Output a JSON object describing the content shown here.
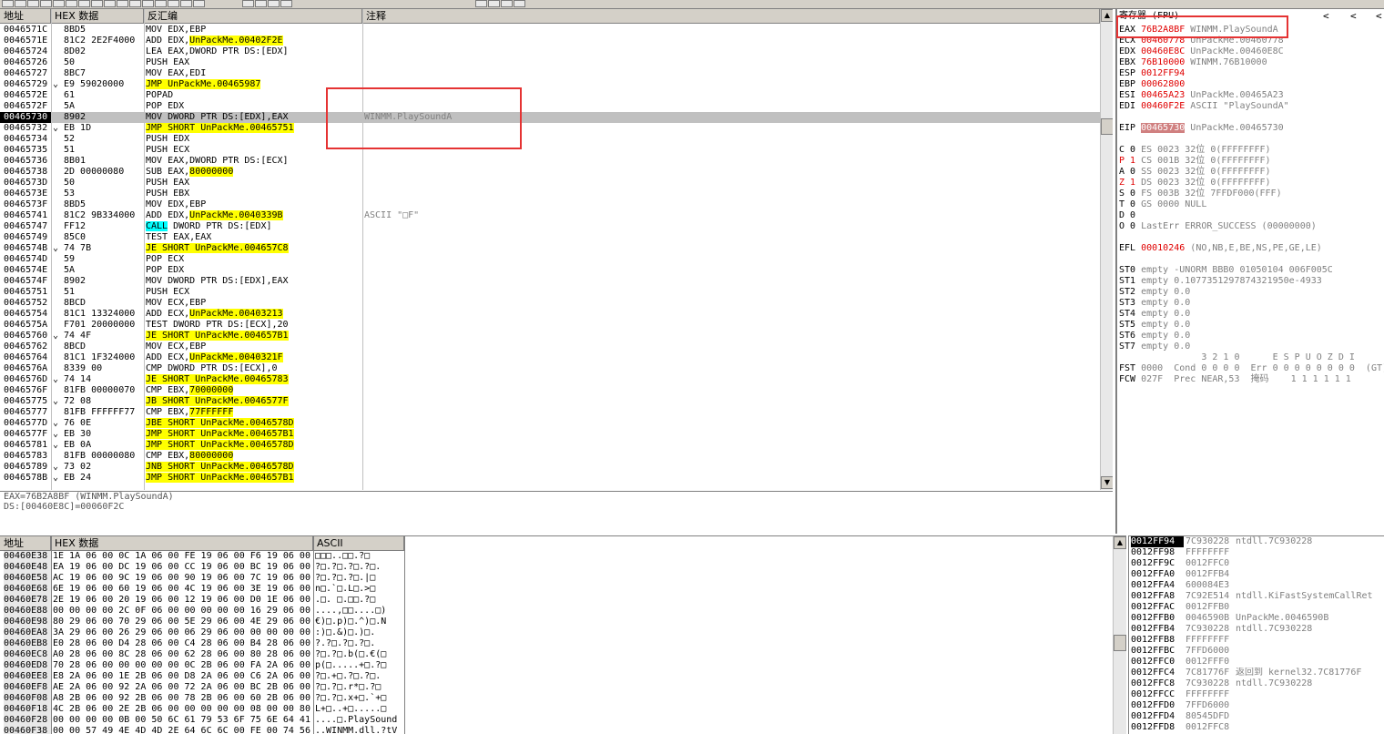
{
  "disasm": {
    "headers": {
      "address": "地址",
      "hex": "HEX 数据",
      "disasm": "反汇编",
      "comment": "注释"
    },
    "rows": [
      {
        "addr": "0046571C",
        "arrow": "",
        "hex": "8BD5",
        "parts": [
          {
            "t": "MOV EDX,EBP"
          }
        ],
        "comment": ""
      },
      {
        "addr": "0046571E",
        "arrow": "",
        "hex": "81C2 2E2F4000",
        "parts": [
          {
            "t": "ADD EDX,"
          },
          {
            "t": "UnPackMe.00402F2E",
            "c": "y"
          }
        ],
        "comment": ""
      },
      {
        "addr": "00465724",
        "arrow": "",
        "hex": "8D02",
        "parts": [
          {
            "t": "LEA EAX,DWORD PTR DS:[EDX]"
          }
        ],
        "comment": ""
      },
      {
        "addr": "00465726",
        "arrow": "",
        "hex": "50",
        "parts": [
          {
            "t": "PUSH EAX"
          }
        ],
        "comment": ""
      },
      {
        "addr": "00465727",
        "arrow": "",
        "hex": "8BC7",
        "parts": [
          {
            "t": "MOV EAX,EDI"
          }
        ],
        "comment": ""
      },
      {
        "addr": "00465729",
        "arrow": "⌄",
        "hex": "E9 59020000",
        "parts": [
          {
            "t": "JMP UnPackMe.00465987",
            "c": "y"
          }
        ],
        "comment": ""
      },
      {
        "addr": "0046572E",
        "arrow": "",
        "hex": "61",
        "parts": [
          {
            "t": "POPAD"
          }
        ],
        "comment": ""
      },
      {
        "addr": "0046572F",
        "arrow": "",
        "hex": "5A",
        "parts": [
          {
            "t": "POP EDX"
          }
        ],
        "comment": ""
      },
      {
        "addr": "00465730",
        "arrow": "",
        "hex": "8902",
        "parts": [
          {
            "t": "MOV DWORD PTR DS:[EDX],EAX"
          }
        ],
        "comment": "WINMM.PlaySoundA",
        "sel": true
      },
      {
        "addr": "00465732",
        "arrow": "⌄",
        "hex": "EB 1D",
        "parts": [
          {
            "t": "JMP SHORT UnPackMe.00465751",
            "c": "y"
          }
        ],
        "comment": ""
      },
      {
        "addr": "00465734",
        "arrow": "",
        "hex": "52",
        "parts": [
          {
            "t": "PUSH EDX"
          }
        ],
        "comment": ""
      },
      {
        "addr": "00465735",
        "arrow": "",
        "hex": "51",
        "parts": [
          {
            "t": "PUSH ECX"
          }
        ],
        "comment": ""
      },
      {
        "addr": "00465736",
        "arrow": "",
        "hex": "8B01",
        "parts": [
          {
            "t": "MOV EAX,DWORD PTR DS:[ECX]"
          }
        ],
        "comment": ""
      },
      {
        "addr": "00465738",
        "arrow": "",
        "hex": "2D 00000080",
        "parts": [
          {
            "t": "SUB EAX,"
          },
          {
            "t": "80000000",
            "c": "y"
          }
        ],
        "comment": ""
      },
      {
        "addr": "0046573D",
        "arrow": "",
        "hex": "50",
        "parts": [
          {
            "t": "PUSH EAX"
          }
        ],
        "comment": ""
      },
      {
        "addr": "0046573E",
        "arrow": "",
        "hex": "53",
        "parts": [
          {
            "t": "PUSH EBX"
          }
        ],
        "comment": ""
      },
      {
        "addr": "0046573F",
        "arrow": "",
        "hex": "8BD5",
        "parts": [
          {
            "t": "MOV EDX,EBP"
          }
        ],
        "comment": ""
      },
      {
        "addr": "00465741",
        "arrow": "",
        "hex": "81C2 9B334000",
        "parts": [
          {
            "t": "ADD EDX,"
          },
          {
            "t": "UnPackMe.0040339B",
            "c": "y"
          }
        ],
        "comment": "ASCII \"□F\""
      },
      {
        "addr": "00465747",
        "arrow": "",
        "hex": "FF12",
        "parts": [
          {
            "t": "CALL",
            "c": "c"
          },
          {
            "t": " DWORD PTR DS:[EDX]"
          }
        ],
        "comment": ""
      },
      {
        "addr": "00465749",
        "arrow": "",
        "hex": "85C0",
        "parts": [
          {
            "t": "TEST EAX,EAX"
          }
        ],
        "comment": ""
      },
      {
        "addr": "0046574B",
        "arrow": "⌄",
        "hex": "74 7B",
        "parts": [
          {
            "t": "JE SHORT UnPackMe.004657C8",
            "c": "y"
          }
        ],
        "comment": ""
      },
      {
        "addr": "0046574D",
        "arrow": "",
        "hex": "59",
        "parts": [
          {
            "t": "POP ECX"
          }
        ],
        "comment": ""
      },
      {
        "addr": "0046574E",
        "arrow": "",
        "hex": "5A",
        "parts": [
          {
            "t": "POP EDX"
          }
        ],
        "comment": ""
      },
      {
        "addr": "0046574F",
        "arrow": "",
        "hex": "8902",
        "parts": [
          {
            "t": "MOV DWORD PTR DS:[EDX],EAX"
          }
        ],
        "comment": ""
      },
      {
        "addr": "00465751",
        "arrow": "",
        "hex": "51",
        "parts": [
          {
            "t": "PUSH ECX"
          }
        ],
        "comment": ""
      },
      {
        "addr": "00465752",
        "arrow": "",
        "hex": "8BCD",
        "parts": [
          {
            "t": "MOV ECX,EBP"
          }
        ],
        "comment": ""
      },
      {
        "addr": "00465754",
        "arrow": "",
        "hex": "81C1 13324000",
        "parts": [
          {
            "t": "ADD ECX,"
          },
          {
            "t": "UnPackMe.00403213",
            "c": "y"
          }
        ],
        "comment": ""
      },
      {
        "addr": "0046575A",
        "arrow": "",
        "hex": "F701 20000000",
        "parts": [
          {
            "t": "TEST DWORD PTR DS:[ECX],20"
          }
        ],
        "comment": ""
      },
      {
        "addr": "00465760",
        "arrow": "⌄",
        "hex": "74 4F",
        "parts": [
          {
            "t": "JE SHORT UnPackMe.004657B1",
            "c": "y"
          }
        ],
        "comment": ""
      },
      {
        "addr": "00465762",
        "arrow": "",
        "hex": "8BCD",
        "parts": [
          {
            "t": "MOV ECX,EBP"
          }
        ],
        "comment": ""
      },
      {
        "addr": "00465764",
        "arrow": "",
        "hex": "81C1 1F324000",
        "parts": [
          {
            "t": "ADD ECX,"
          },
          {
            "t": "UnPackMe.0040321F",
            "c": "y"
          }
        ],
        "comment": ""
      },
      {
        "addr": "0046576A",
        "arrow": "",
        "hex": "8339 00",
        "parts": [
          {
            "t": "CMP DWORD PTR DS:[ECX],0"
          }
        ],
        "comment": ""
      },
      {
        "addr": "0046576D",
        "arrow": "⌄",
        "hex": "74 14",
        "parts": [
          {
            "t": "JE SHORT UnPackMe.00465783",
            "c": "y"
          }
        ],
        "comment": ""
      },
      {
        "addr": "0046576F",
        "arrow": "",
        "hex": "81FB 00000070",
        "parts": [
          {
            "t": "CMP EBX,"
          },
          {
            "t": "70000000",
            "c": "y"
          }
        ],
        "comment": ""
      },
      {
        "addr": "00465775",
        "arrow": "⌄",
        "hex": "72 08",
        "parts": [
          {
            "t": "JB SHORT UnPackMe.0046577F",
            "c": "y"
          }
        ],
        "comment": ""
      },
      {
        "addr": "00465777",
        "arrow": "",
        "hex": "81FB FFFFFF77",
        "parts": [
          {
            "t": "CMP EBX,"
          },
          {
            "t": "77FFFFFF",
            "c": "y"
          }
        ],
        "comment": ""
      },
      {
        "addr": "0046577D",
        "arrow": "⌄",
        "hex": "76 0E",
        "parts": [
          {
            "t": "JBE SHORT UnPackMe.0046578D",
            "c": "y"
          }
        ],
        "comment": ""
      },
      {
        "addr": "0046577F",
        "arrow": "⌄",
        "hex": "EB 30",
        "parts": [
          {
            "t": "JMP SHORT UnPackMe.004657B1",
            "c": "y"
          }
        ],
        "comment": ""
      },
      {
        "addr": "00465781",
        "arrow": "⌄",
        "hex": "EB 0A",
        "parts": [
          {
            "t": "JMP SHORT UnPackMe.0046578D",
            "c": "y"
          }
        ],
        "comment": ""
      },
      {
        "addr": "00465783",
        "arrow": "",
        "hex": "81FB 00000080",
        "parts": [
          {
            "t": "CMP EBX,"
          },
          {
            "t": "80000000",
            "c": "y"
          }
        ],
        "comment": ""
      },
      {
        "addr": "00465789",
        "arrow": "⌄",
        "hex": "73 02",
        "parts": [
          {
            "t": "JNB SHORT UnPackMe.0046578D",
            "c": "y"
          }
        ],
        "comment": ""
      },
      {
        "addr": "0046578B",
        "arrow": "⌄",
        "hex": "EB 24",
        "parts": [
          {
            "t": "JMP SHORT UnPackMe.004657B1",
            "c": "y"
          }
        ],
        "comment": ""
      }
    ],
    "info_lines": [
      "EAX=76B2A8BF (WINMM.PlaySoundA)",
      "DS:[00460E8C]=00060F2C"
    ]
  },
  "registers": {
    "title": "寄存器 (FPU)",
    "nav": [
      "<",
      "<",
      "<"
    ],
    "lines": [
      {
        "k": "EAX",
        "v": "76B2A8BF",
        "note": "WINMM.PlaySoundA",
        "vc": "red"
      },
      {
        "k": "ECX",
        "v": "00460778",
        "note": "UnPackMe.00460778",
        "vc": "red"
      },
      {
        "k": "EDX",
        "v": "00460E8C",
        "note": "UnPackMe.00460E8C",
        "vc": "red"
      },
      {
        "k": "EBX",
        "v": "76B10000",
        "note": "WINMM.76B10000",
        "vc": "red"
      },
      {
        "k": "ESP",
        "v": "0012FF94",
        "note": "",
        "vc": "red"
      },
      {
        "k": "EBP",
        "v": "00062800",
        "note": "",
        "vc": "red"
      },
      {
        "k": "ESI",
        "v": "00465A23",
        "note": "UnPackMe.00465A23",
        "vc": "red"
      },
      {
        "k": "EDI",
        "v": "00460F2E",
        "note": "ASCII \"PlaySoundA\"",
        "vc": "red"
      },
      {
        "k": "",
        "v": "",
        "note": ""
      },
      {
        "k": "EIP",
        "v": "00465730",
        "note": "UnPackMe.00465730",
        "vc": "eip"
      },
      {
        "k": "",
        "v": "",
        "note": ""
      },
      {
        "k": "C 0",
        "v": "",
        "note": "ES 0023 32位 0(FFFFFFFF)"
      },
      {
        "k": "P 1",
        "v": "",
        "note": "CS 001B 32位 0(FFFFFFFF)",
        "kc": "red"
      },
      {
        "k": "A 0",
        "v": "",
        "note": "SS 0023 32位 0(FFFFFFFF)"
      },
      {
        "k": "Z 1",
        "v": "",
        "note": "DS 0023 32位 0(FFFFFFFF)",
        "kc": "red"
      },
      {
        "k": "S 0",
        "v": "",
        "note": "FS 003B 32位 7FFDF000(FFF)"
      },
      {
        "k": "T 0",
        "v": "",
        "note": "GS 0000 NULL"
      },
      {
        "k": "D 0",
        "v": "",
        "note": ""
      },
      {
        "k": "O 0",
        "v": "",
        "note": "LastErr ERROR_SUCCESS (00000000)"
      },
      {
        "k": "",
        "v": "",
        "note": ""
      },
      {
        "k": "EFL",
        "v": "00010246",
        "note": "(NO,NB,E,BE,NS,PE,GE,LE)",
        "vc": "red"
      },
      {
        "k": "",
        "v": "",
        "note": ""
      },
      {
        "k": "ST0",
        "v": "",
        "note": "empty -UNORM BBB0 01050104 006F005C"
      },
      {
        "k": "ST1",
        "v": "",
        "note": "empty 0.1077351297874321950e-4933"
      },
      {
        "k": "ST2",
        "v": "",
        "note": "empty 0.0"
      },
      {
        "k": "ST3",
        "v": "",
        "note": "empty 0.0"
      },
      {
        "k": "ST4",
        "v": "",
        "note": "empty 0.0"
      },
      {
        "k": "ST5",
        "v": "",
        "note": "empty 0.0"
      },
      {
        "k": "ST6",
        "v": "",
        "note": "empty 0.0"
      },
      {
        "k": "ST7",
        "v": "",
        "note": "empty 0.0"
      },
      {
        "k": "",
        "v": "",
        "note": "              3 2 1 0      E S P U O Z D I"
      },
      {
        "k": "FST",
        "v": "",
        "note": "0000  Cond 0 0 0 0  Err 0 0 0 0 0 0 0 0  (GT)"
      },
      {
        "k": "FCW",
        "v": "",
        "note": "027F  Prec NEAR,53  掩码    1 1 1 1 1 1"
      }
    ]
  },
  "dump": {
    "headers": {
      "address": "地址",
      "hex": "HEX 数据",
      "ascii": "ASCII"
    },
    "rows": [
      {
        "addr": "00460E38",
        "hex": "1E 1A 06 00 0C 1A 06 00 FE 19 06 00 F6 19 06 00",
        "ascii": "□□□..□□.?□"
      },
      {
        "addr": "00460E48",
        "hex": "EA 19 06 00 DC 19 06 00 CC 19 06 00 BC 19 06 00",
        "ascii": "?□.?□.?□.?□."
      },
      {
        "addr": "00460E58",
        "hex": "AC 19 06 00 9C 19 06 00 90 19 06 00 7C 19 06 00",
        "ascii": "?□.?□.?□.|□"
      },
      {
        "addr": "00460E68",
        "hex": "6E 19 06 00 60 19 06 00 4C 19 06 00 3E 19 06 00",
        "ascii": "n□.`□.L□.>□"
      },
      {
        "addr": "00460E78",
        "hex": "2E 19 06 00 20 19 06 00 12 19 06 00 D0 1E 06 00",
        "ascii": ".□. □.□□.?□"
      },
      {
        "addr": "00460E88",
        "hex": "00 00 00 00 2C 0F 06 00 00 00 00 00 16 29 06 00",
        "ascii": "....,□□....□)"
      },
      {
        "addr": "00460E98",
        "hex": "80 29 06 00 70 29 06 00 5E 29 06 00 4E 29 06 00",
        "ascii": "€)□.p)□.^)□.N"
      },
      {
        "addr": "00460EA8",
        "hex": "3A 29 06 00 26 29 06 00 06 29 06 00 00 00 00 00",
        "ascii": ":)□.&)□.)□."
      },
      {
        "addr": "00460EB8",
        "hex": "E0 28 06 00 D4 28 06 00 C4 28 06 00 B4 28 06 00",
        "ascii": "?.?□.?□.?□."
      },
      {
        "addr": "00460EC8",
        "hex": "A0 28 06 00 8C 28 06 00 62 28 06 00 80 28 06 00",
        "ascii": "?□.?□.b(□.€(□"
      },
      {
        "addr": "00460ED8",
        "hex": "70 28 06 00 00 00 00 00 0C 2B 06 00 FA 2A 06 00",
        "ascii": "p(□.....+□.?□"
      },
      {
        "addr": "00460EE8",
        "hex": "E8 2A 06 00 1E 2B 06 00 D8 2A 06 00 C6 2A 06 00",
        "ascii": "?□.+□.?□.?□."
      },
      {
        "addr": "00460EF8",
        "hex": "AE 2A 06 00 92 2A 06 00 72 2A 06 00 BC 2B 06 00",
        "ascii": "?□.?□.r*□.?□"
      },
      {
        "addr": "00460F08",
        "hex": "A8 2B 06 00 92 2B 06 00 78 2B 06 00 60 2B 06 00",
        "ascii": "?□.?□.x+□.`+□"
      },
      {
        "addr": "00460F18",
        "hex": "4C 2B 06 00 2E 2B 06 00 00 00 00 00 08 00 00 80",
        "ascii": "L+□..+□.....□"
      },
      {
        "addr": "00460F28",
        "hex": "00 00 00 00 0B 00 50 6C 61 79 53 6F 75 6E 64 41",
        "ascii": "....□.PlaySound"
      },
      {
        "addr": "00460F38",
        "hex": "00 00 57 49 4E 4D 4D 2E 64 6C 6C 00 FE 00 74 56",
        "ascii": "..WINMM.dll.?tV"
      }
    ]
  },
  "stack": {
    "rows": [
      {
        "addr": "0012FF94",
        "val": "7C930228",
        "note": "ntdll.7C930228",
        "sel": true
      },
      {
        "addr": "0012FF98",
        "val": "FFFFFFFF",
        "note": ""
      },
      {
        "addr": "0012FF9C",
        "val": "0012FFC0",
        "note": ""
      },
      {
        "addr": "0012FFA0",
        "val": "0012FFB4",
        "note": ""
      },
      {
        "addr": "0012FFA4",
        "val": "600084E3",
        "note": ""
      },
      {
        "addr": "0012FFA8",
        "val": "7C92E514",
        "note": "ntdll.KiFastSystemCallRet"
      },
      {
        "addr": "0012FFAC",
        "val": "0012FFB0",
        "note": ""
      },
      {
        "addr": "0012FFB0",
        "val": "0046590B",
        "note": "UnPackMe.0046590B"
      },
      {
        "addr": "0012FFB4",
        "val": "7C930228",
        "note": "ntdll.7C930228"
      },
      {
        "addr": "0012FFB8",
        "val": "FFFFFFFF",
        "note": ""
      },
      {
        "addr": "0012FFBC",
        "val": "7FFD6000",
        "note": ""
      },
      {
        "addr": "0012FFC0",
        "val": "0012FFF0",
        "note": ""
      },
      {
        "addr": "0012FFC4",
        "val": "7C81776F",
        "note": "返回到 kernel32.7C81776F"
      },
      {
        "addr": "0012FFC8",
        "val": "7C930228",
        "note": "ntdll.7C930228"
      },
      {
        "addr": "0012FFCC",
        "val": "FFFFFFFF",
        "note": ""
      },
      {
        "addr": "0012FFD0",
        "val": "7FFD6000",
        "note": ""
      },
      {
        "addr": "0012FFD4",
        "val": "80545DFD",
        "note": ""
      },
      {
        "addr": "0012FFD8",
        "val": "0012FFC8",
        "note": ""
      }
    ]
  },
  "colors": {
    "accent_red": "#e53333",
    "jump_highlight": "#ffff00",
    "call_highlight": "#00ffff",
    "panel": "#d4d0c8"
  }
}
